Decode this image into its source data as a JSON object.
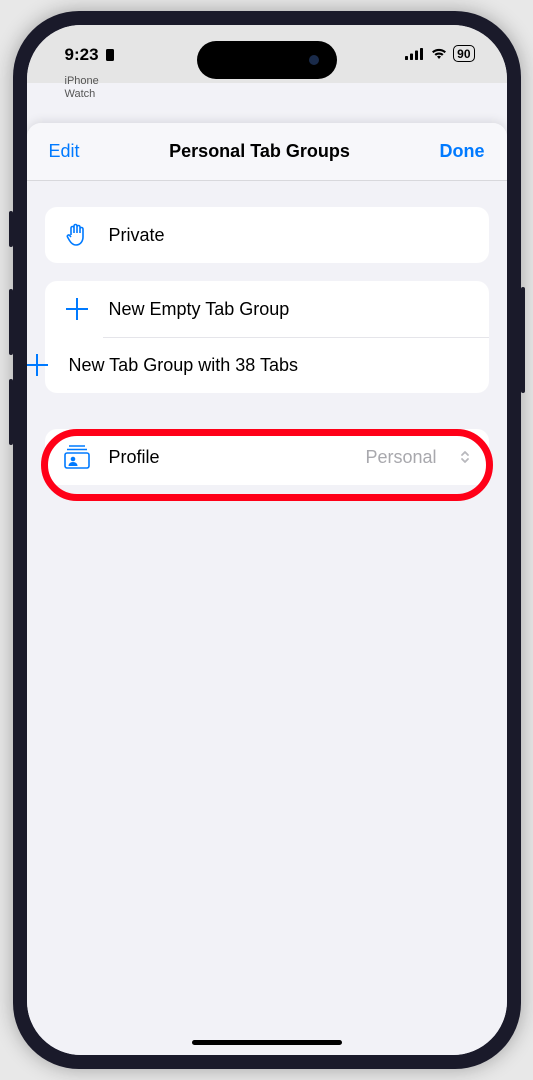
{
  "status_bar": {
    "time": "9:23",
    "battery_percent": "90",
    "background_app1": "iPhone",
    "background_app2": "Watch"
  },
  "sheet": {
    "edit_label": "Edit",
    "title": "Personal Tab Groups",
    "done_label": "Done"
  },
  "private_row": {
    "label": "Private"
  },
  "new_group": {
    "empty_label": "New Empty Tab Group",
    "with_tabs_label": "New Tab Group with 38 Tabs"
  },
  "profile": {
    "label": "Profile",
    "value": "Personal"
  }
}
